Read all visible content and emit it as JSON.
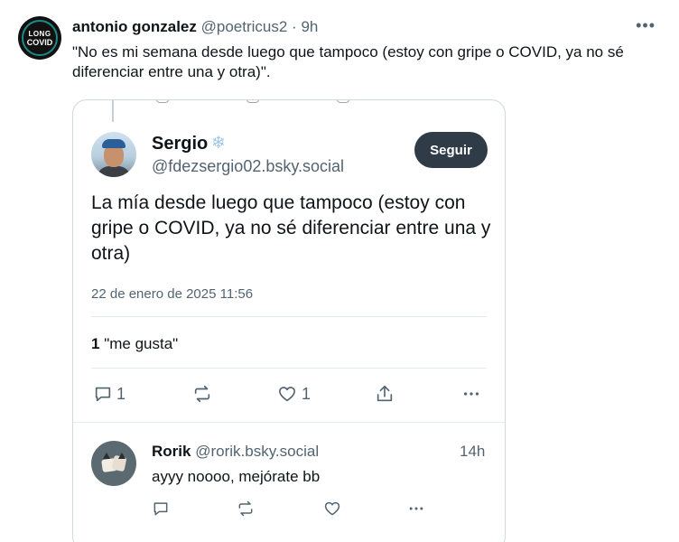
{
  "outer_post": {
    "author_name": "antonio gonzalez",
    "author_handle": "@poetricus2",
    "separator": " · ",
    "time": "9h",
    "text": "\"No es mi semana desde luego que tampoco (estoy con gripe o COVID, ya no sé diferenciar entre una y otra)\".",
    "avatar_text_line1": "LONG",
    "avatar_text_line2": "COVID",
    "more_icon": "more-horizontal-icon"
  },
  "embedded_post": {
    "author_name": "Sergio",
    "author_badge_icon": "snowflake-icon",
    "author_handle": "@fdezsergio02.bsky.social",
    "follow_label": "Seguir",
    "text": "La mía desde luego que tampoco (estoy con gripe o COVID, ya no sé diferenciar entre una y otra)",
    "date": "22 de enero de 2025 11:56",
    "likes_count": "1",
    "likes_label": "\"me gusta\"",
    "actions": {
      "reply_count": "1",
      "repost_count": "",
      "like_count": "1"
    }
  },
  "reply": {
    "author_name": "Rorik",
    "author_handle": "@rorik.bsky.social",
    "time": "14h",
    "text": "ayyy noooo, mejórate bb"
  },
  "colors": {
    "text_primary": "#0f1419",
    "text_secondary": "#536471",
    "border": "#cfd9de",
    "follow_button": "#2f3c48"
  }
}
